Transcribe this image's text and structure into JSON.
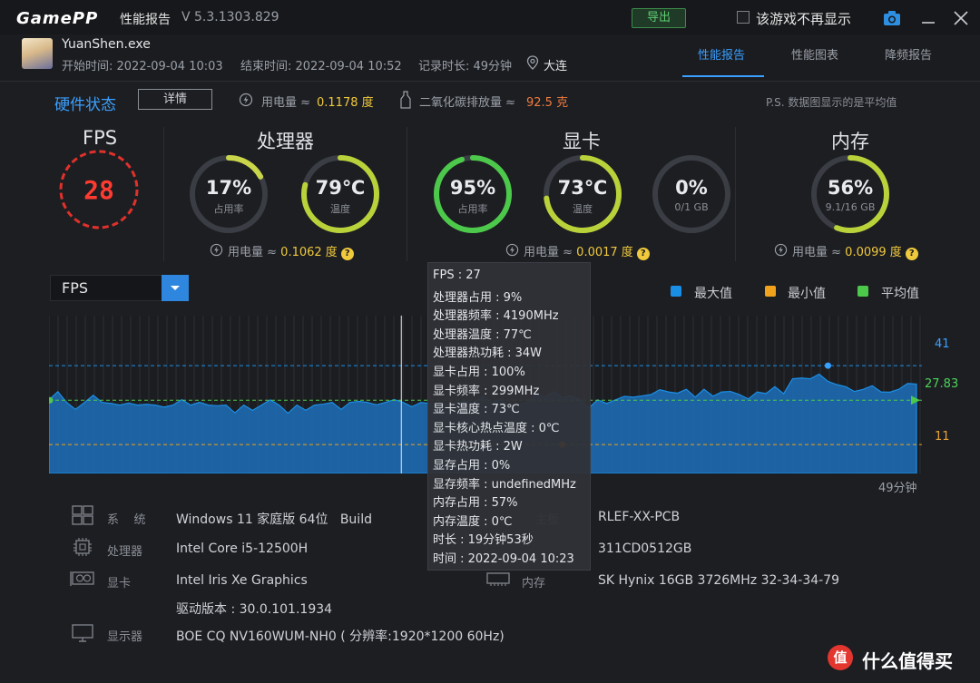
{
  "titlebar": {
    "logo": "GamePP",
    "title": "性能报告",
    "version": "V 5.3.1303.829",
    "export_label": "导出",
    "dont_show_label": "该游戏不再显示"
  },
  "header": {
    "exe": "YuanShen.exe",
    "start": "开始时间: 2022-09-04 10:03",
    "end": "结束时间: 2022-09-04 10:52",
    "duration": "记录时长: 49分钟",
    "location": "大连",
    "tabs": [
      "性能报告",
      "性能图表",
      "降频报告"
    ]
  },
  "hardware": {
    "title": "硬件状态",
    "detail_label": "详情",
    "power_label": "用电量 ≈",
    "power_value": "0.1178 度",
    "co2_label": "二氧化碳排放量 ≈",
    "co2_value": "92.5 克",
    "note": "P.S. 数据图显示的是平均值"
  },
  "sections": {
    "fps": {
      "title": "FPS",
      "value": "28"
    },
    "cpu": {
      "title": "处理器",
      "usage": {
        "value": "17%",
        "label": "占用率",
        "fraction": 0.17
      },
      "temp": {
        "value": "79℃",
        "label": "温度",
        "fraction": 0.79
      },
      "power_label": "用电量 ≈",
      "power_value": "0.1062 度"
    },
    "gpu": {
      "title": "显卡",
      "usage": {
        "value": "95%",
        "label": "占用率",
        "fraction": 0.95
      },
      "temp": {
        "value": "73℃",
        "label": "温度",
        "fraction": 0.73
      },
      "vram": {
        "value": "0%",
        "label": "0/1 GB",
        "fraction": 0.0
      },
      "power_label": "用电量 ≈",
      "power_value": "0.0017 度"
    },
    "mem": {
      "title": "内存",
      "usage": {
        "value": "56%",
        "label": "9.1/16 GB",
        "fraction": 0.56
      },
      "power_label": "用电量 ≈",
      "power_value": "0.0099 度"
    }
  },
  "chart": {
    "select_label": "FPS",
    "legend": [
      "最大值",
      "最小值",
      "平均值"
    ],
    "max_label": "41",
    "avg_label": "27.83",
    "min_label": "11",
    "duration_label": "49分钟",
    "colors": {
      "max": "#1a8fe6",
      "min": "#f0a21c",
      "avg": "#4cc94a",
      "fill": "#1d6fb8"
    }
  },
  "chart_data": {
    "type": "area",
    "x_unit": "minutes",
    "xlim": [
      0,
      49
    ],
    "ylim": [
      0,
      60
    ],
    "max": 41,
    "min": 11,
    "avg": 27.83,
    "series": [
      {
        "name": "FPS",
        "x": [
          0,
          1,
          2,
          3,
          4,
          5,
          6,
          7,
          8,
          9,
          10,
          11,
          12,
          13,
          14,
          15,
          16,
          17,
          18,
          19,
          20,
          21,
          22,
          23,
          24,
          25,
          26,
          27,
          28,
          29,
          30,
          31,
          32,
          33,
          34,
          35,
          36,
          37,
          38,
          39,
          40,
          41,
          42,
          43,
          44,
          45,
          46,
          47,
          48,
          49
        ],
        "values": [
          28,
          27,
          27,
          27,
          26,
          26,
          26,
          26,
          26,
          26,
          26,
          26,
          26,
          26,
          26,
          26,
          27,
          27,
          27,
          27,
          27,
          27,
          27,
          27,
          27,
          27,
          26,
          27,
          29,
          29,
          28,
          28,
          28,
          29,
          30,
          31,
          32,
          32,
          31,
          30,
          31,
          33,
          36,
          36,
          35,
          33,
          32,
          31,
          32,
          34
        ]
      }
    ]
  },
  "tooltip": {
    "lines": [
      "FPS : 27",
      "处理器占用 : 9%",
      "处理器频率 : 4190MHz",
      "处理器温度 : 77℃",
      "处理器热功耗 : 34W",
      "显卡占用 : 100%",
      "显卡频率 : 299MHz",
      "显卡温度 : 73℃",
      "显卡核心热点温度 : 0℃",
      "显卡热功耗 : 2W",
      "显存占用 : 0%",
      "显存频率 : undefinedMHz",
      "内存占用 : 57%",
      "内存温度 : 0℃",
      "时长 : 19分钟53秒",
      "时间 : 2022-09-04 10:23"
    ]
  },
  "system": {
    "os_label": "系    统",
    "os_value": "Windows 11 家庭版 64位   Build",
    "cpu_label": "处理器",
    "cpu_value": "Intel Core i5-12500H",
    "gpu_label": "显卡",
    "gpu_value": "Intel Iris Xe Graphics",
    "driver_value": "驱动版本 : 30.0.101.1934",
    "display_label": "显示器",
    "display_value": "BOE CQ NV160WUM-NH0 ( 分辨率:1920*1200 60Hz)",
    "mb_label": "主板",
    "mb_value": "RLEF-XX-PCB",
    "storage_value": "311CD0512GB",
    "ram_label": "内存",
    "ram_value": "SK Hynix 16GB 3726MHz 32-34-34-79"
  },
  "watermark": {
    "text": "什么值得买",
    "logo_char": "值"
  }
}
